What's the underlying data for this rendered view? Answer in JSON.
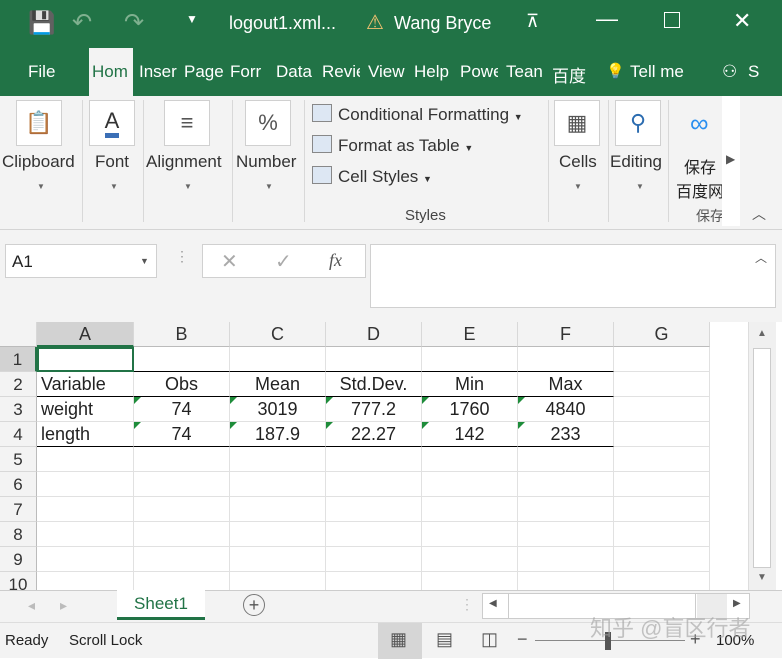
{
  "title": {
    "file": "logout1.xml...",
    "user": "Wang Bryce",
    "warning_icon": "warning-icon"
  },
  "tabs": [
    "File",
    "Hom",
    "Inser",
    "Page",
    "Forr",
    "Data",
    "Revie",
    "View",
    "Help",
    "Powe",
    "Tean",
    "百度",
    "Tell me",
    "S"
  ],
  "ribbon": {
    "clipboard": "Clipboard",
    "font": "Font",
    "alignment": "Alignment",
    "number": "Number",
    "conditional": "Conditional Formatting",
    "format_table": "Format as Table",
    "cell_styles": "Cell Styles",
    "styles": "Styles",
    "cells": "Cells",
    "editing": "Editing",
    "baidu1": "保存",
    "baidu2": "百度网",
    "baidu3": "保存"
  },
  "formula": {
    "name_box": "A1",
    "fx": "fx",
    "value": ""
  },
  "columns": [
    "A",
    "B",
    "C",
    "D",
    "E",
    "F",
    "G"
  ],
  "rows": [
    "1",
    "2",
    "3",
    "4",
    "5",
    "6",
    "7",
    "8",
    "9",
    "10"
  ],
  "table": {
    "header": [
      "Variable",
      "Obs",
      "Mean",
      "Std.Dev.",
      "Min",
      "Max"
    ],
    "data": [
      [
        "weight",
        "74",
        "3019",
        "777.2",
        "1760",
        "4840"
      ],
      [
        "length",
        "74",
        "187.9",
        "22.27",
        "142",
        "233"
      ]
    ]
  },
  "sheet": {
    "name": "Sheet1"
  },
  "status": {
    "ready": "Ready",
    "scroll_lock": "Scroll Lock",
    "zoom": "100%",
    "watermark": "知乎 @盲区行者"
  }
}
